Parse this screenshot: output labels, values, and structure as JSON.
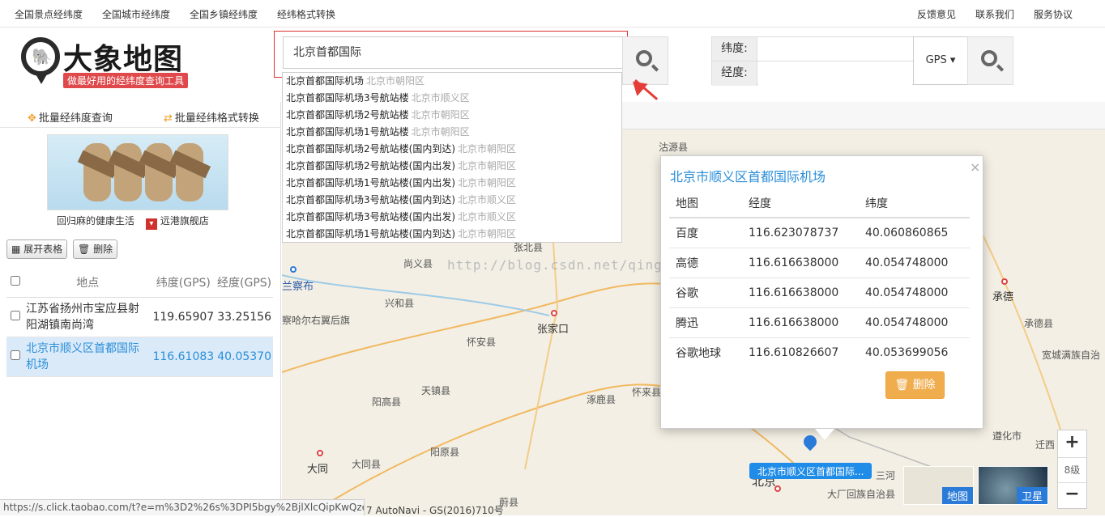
{
  "topnav": {
    "left": [
      "全国景点经纬度",
      "全国城市经纬度",
      "全国乡镇经纬度",
      "经纬格式转换"
    ],
    "right": [
      "反馈意见",
      "联系我们",
      "服务协议"
    ]
  },
  "logo": {
    "name": "大象地图",
    "tagline": "做最好用的经纬度查询工具"
  },
  "search": {
    "value": "北京首都国际",
    "suggestions": [
      {
        "name": "北京首都国际机场",
        "district": "北京市朝阳区"
      },
      {
        "name": "北京首都国际机场3号航站楼",
        "district": "北京市顺义区"
      },
      {
        "name": "北京首都国际机场2号航站楼",
        "district": "北京市朝阳区"
      },
      {
        "name": "北京首都国际机场1号航站楼",
        "district": "北京市朝阳区"
      },
      {
        "name": "北京首都国际机场2号航站楼(国内到达)",
        "district": "北京市朝阳区"
      },
      {
        "name": "北京首都国际机场2号航站楼(国内出发)",
        "district": "北京市朝阳区"
      },
      {
        "name": "北京首都国际机场1号航站楼(国内出发)",
        "district": "北京市朝阳区"
      },
      {
        "name": "北京首都国际机场3号航站楼(国内到达)",
        "district": "北京市顺义区"
      },
      {
        "name": "北京首都国际机场3号航站楼(国内出发)",
        "district": "北京市顺义区"
      },
      {
        "name": "北京首都国际机场1号航站楼(国内到达)",
        "district": "北京市朝阳区"
      }
    ]
  },
  "coord": {
    "lat_label": "纬度:",
    "lng_label": "经度:",
    "format": "GPS ▾"
  },
  "sidebar": {
    "batch_query": "批量经纬度查询",
    "batch_convert": "批量经纬格式转换",
    "ad_caption": "回归麻的健康生活",
    "ad_shop": "远港旗舰店",
    "expand_btn": "展开表格",
    "delete_btn": "删除",
    "table": {
      "headers": [
        "地点",
        "纬度(GPS)",
        "经度(GPS)"
      ],
      "rows": [
        {
          "place": "江苏省扬州市宝应县射阳湖镇南尚湾",
          "lat": "119.65907",
          "lng": "33.25156"
        },
        {
          "place": "北京市顺义区首都国际机场",
          "lat": "116.61083",
          "lng": "40.05370"
        }
      ]
    }
  },
  "map": {
    "labels": [
      "沽源县",
      "张北县",
      "尚义县",
      "兴和县",
      "察哈尔右翼后旗",
      "张家口",
      "怀安县",
      "阳高县",
      "天镇县",
      "涿鹿县",
      "怀来县",
      "大同",
      "大同县",
      "阳原县",
      "蔚县",
      "承德",
      "承德县",
      "宽城满族自治",
      "遵化市",
      "迁西",
      "兰察布",
      "北京",
      "大厂回族自治县",
      "三河"
    ],
    "marker_label": "北京市顺义区首都国际...",
    "zoom_level": "8级",
    "thumb_map": "地图",
    "thumb_satellite": "卫星",
    "copyright": "7 AutoNavi - GS(2016)710号",
    "watermark": "http://blog.csdn.net/qing387"
  },
  "popup": {
    "title": "北京市顺义区首都国际机场",
    "headers": [
      "地图",
      "经度",
      "纬度"
    ],
    "rows": [
      [
        "百度",
        "116.623078737",
        "40.060860865"
      ],
      [
        "高德",
        "116.616638000",
        "40.054748000"
      ],
      [
        "谷歌",
        "116.616638000",
        "40.054748000"
      ],
      [
        "腾迅",
        "116.616638000",
        "40.054748000"
      ],
      [
        "谷歌地球",
        "116.610826607",
        "40.053699056"
      ]
    ],
    "delete": "删除"
  },
  "statusbar": "https://s.click.taobao.com/t?e=m%3D2%26s%3DPI5bgy%2BjlXlcQipKwQzeP..."
}
